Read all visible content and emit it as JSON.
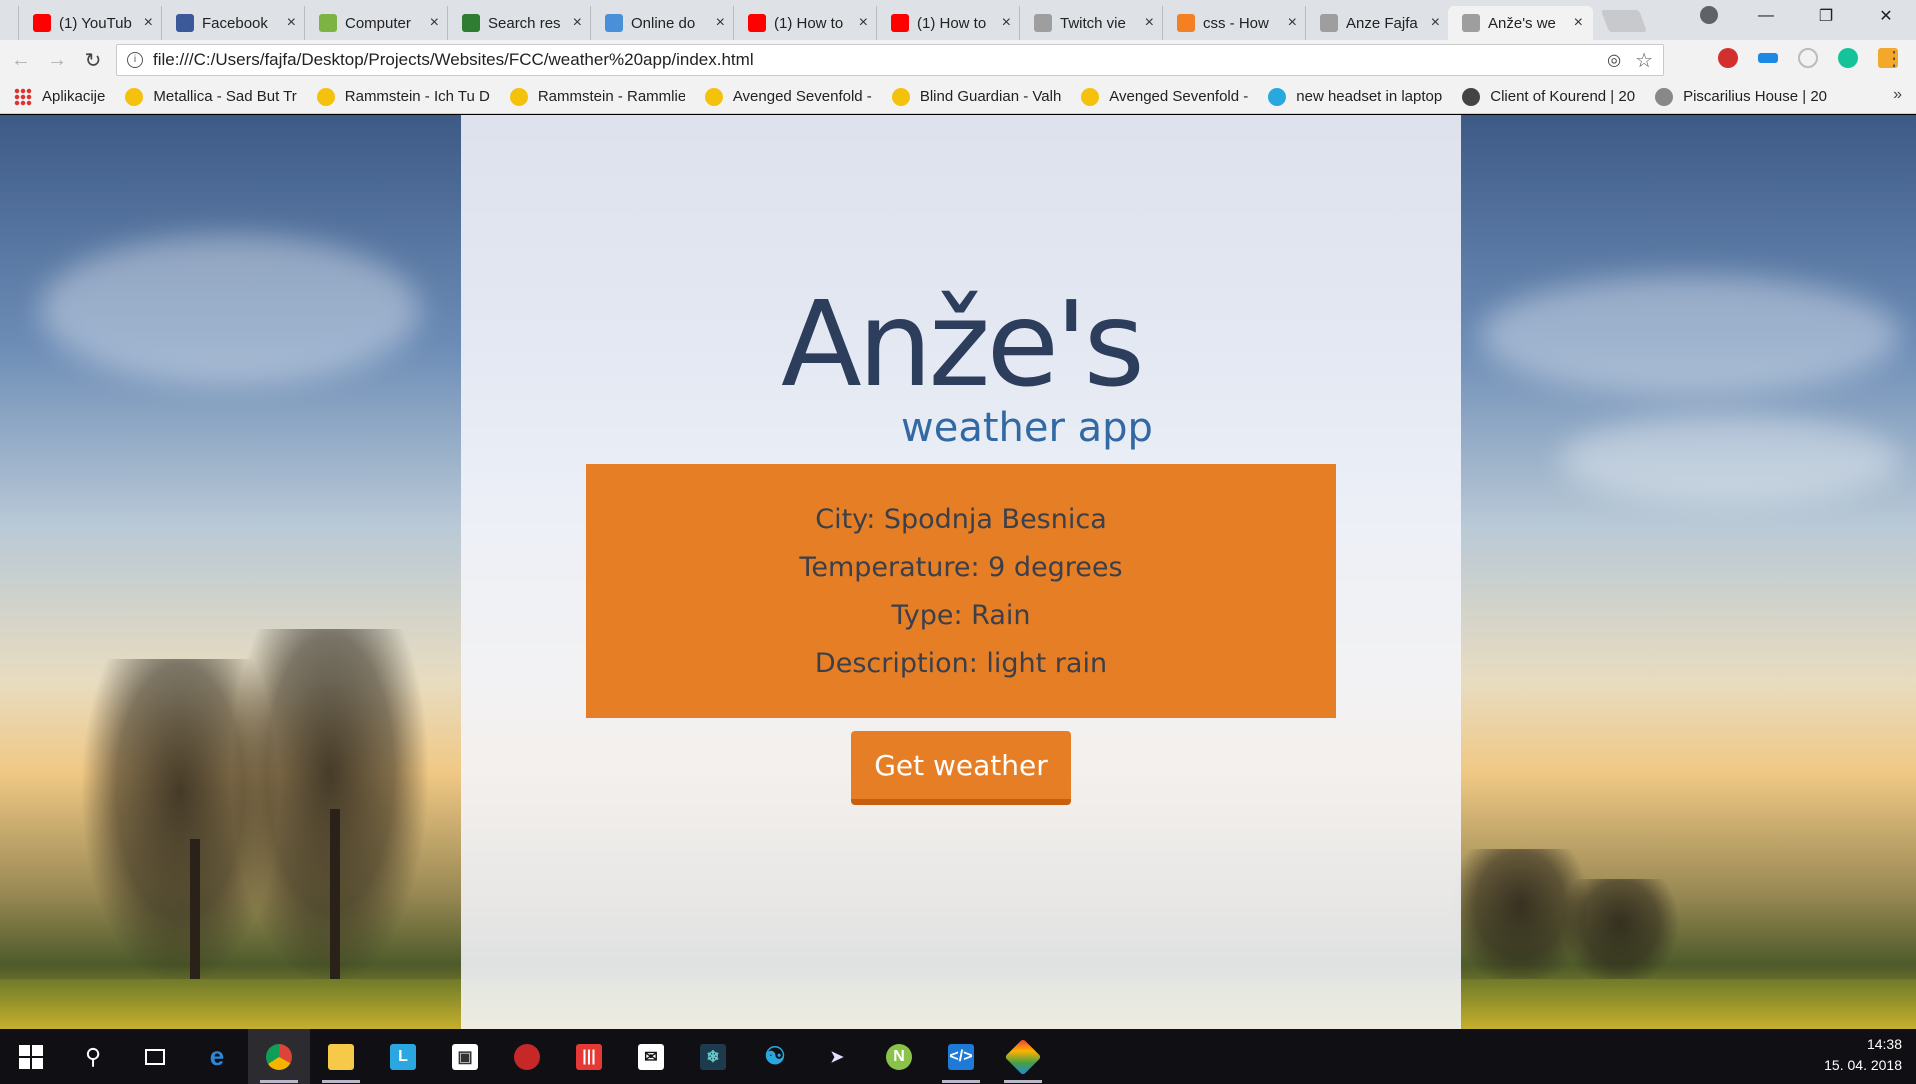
{
  "tabs": [
    {
      "title": "(1) YouTub",
      "icon": "youtube-icon",
      "color": "#ff0000"
    },
    {
      "title": "Facebook",
      "icon": "facebook-icon",
      "color": "#3b5998"
    },
    {
      "title": "Computer",
      "icon": "p-logo-icon",
      "color": "#7cb342"
    },
    {
      "title": "Search res",
      "icon": "filter-funnel-icon",
      "color": "#2e7d32"
    },
    {
      "title": "Online do",
      "icon": "converter-icon",
      "color": "#4a90d9"
    },
    {
      "title": "(1) How to",
      "icon": "youtube-icon",
      "color": "#ff0000"
    },
    {
      "title": "(1) How to",
      "icon": "youtube-icon",
      "color": "#ff0000"
    },
    {
      "title": "Twitch vie",
      "icon": "page-icon",
      "color": "#9e9e9e"
    },
    {
      "title": "css - How",
      "icon": "stackoverflow-icon",
      "color": "#f48024"
    },
    {
      "title": "Anze Fajfa",
      "icon": "page-icon",
      "color": "#9e9e9e"
    },
    {
      "title": "Anže's we",
      "icon": "page-icon",
      "color": "#9e9e9e",
      "active": true
    }
  ],
  "address": {
    "url": "file:///C:/Users/fajfa/Desktop/Projects/Websites/FCC/weather%20app/index.html"
  },
  "bookmarks": [
    {
      "label": "Aplikacije",
      "icon": "apps-grid-icon"
    },
    {
      "label": "Metallica - Sad But Tr",
      "icon": "shield-g-icon"
    },
    {
      "label": "Rammstein - Ich Tu D",
      "icon": "shield-g-icon"
    },
    {
      "label": "Rammstein - Rammlie",
      "icon": "shield-g-icon"
    },
    {
      "label": "Avenged Sevenfold -",
      "icon": "shield-g-icon"
    },
    {
      "label": "Blind Guardian - Valh",
      "icon": "shield-g-icon"
    },
    {
      "label": "Avenged Sevenfold -",
      "icon": "shield-g-icon"
    },
    {
      "label": "new headset in laptop",
      "icon": "up-arrow-icon"
    },
    {
      "label": "Client of Kourend | 20",
      "icon": "skull-icon"
    },
    {
      "label": "Piscarilius House | 20",
      "icon": "sword-icon"
    }
  ],
  "page": {
    "title": "Anže's",
    "subtitle": "weather app",
    "weather": {
      "city": "City: Spodnja Besnica",
      "temperature": "Temperature: 9 degrees",
      "type": "Type: Rain",
      "description": "Description: light rain"
    },
    "button_label": "Get weather"
  },
  "taskbar": {
    "time": "14:38",
    "date": "15. 04. 2018"
  },
  "colors": {
    "accent": "#e67e25",
    "title": "#2c3e5c",
    "subtitle": "#3369a3"
  }
}
